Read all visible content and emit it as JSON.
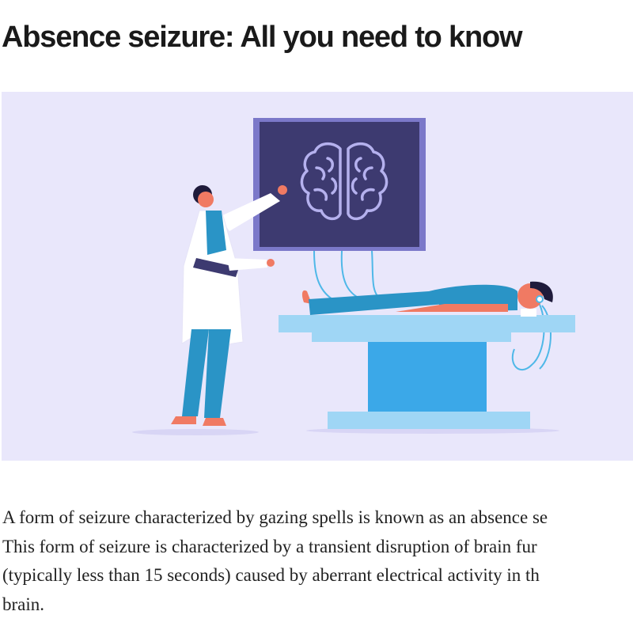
{
  "article": {
    "title": "Absence seizure: All you need to know",
    "paragraph_lines": [
      "A form of seizure characterized by gazing spells is known as an absence se",
      "This form of seizure is characterized by a transient disruption of brain fur",
      "(typically less than 15 seconds) caused by aberrant electrical activity in th",
      "brain."
    ]
  },
  "illustration": {
    "background": "#e9e7fb",
    "palette": {
      "monitor_frame": "#7b78c9",
      "monitor_screen": "#3d3a70",
      "brain": "#b5b1ee",
      "cable": "#4fb8e8",
      "table": "#9fd6f5",
      "table_column": "#3ba8e8",
      "scrubs": "#2a94c6",
      "skin": "#f07a63",
      "coat": "#ffffff",
      "hair": "#1f1b3b"
    }
  }
}
